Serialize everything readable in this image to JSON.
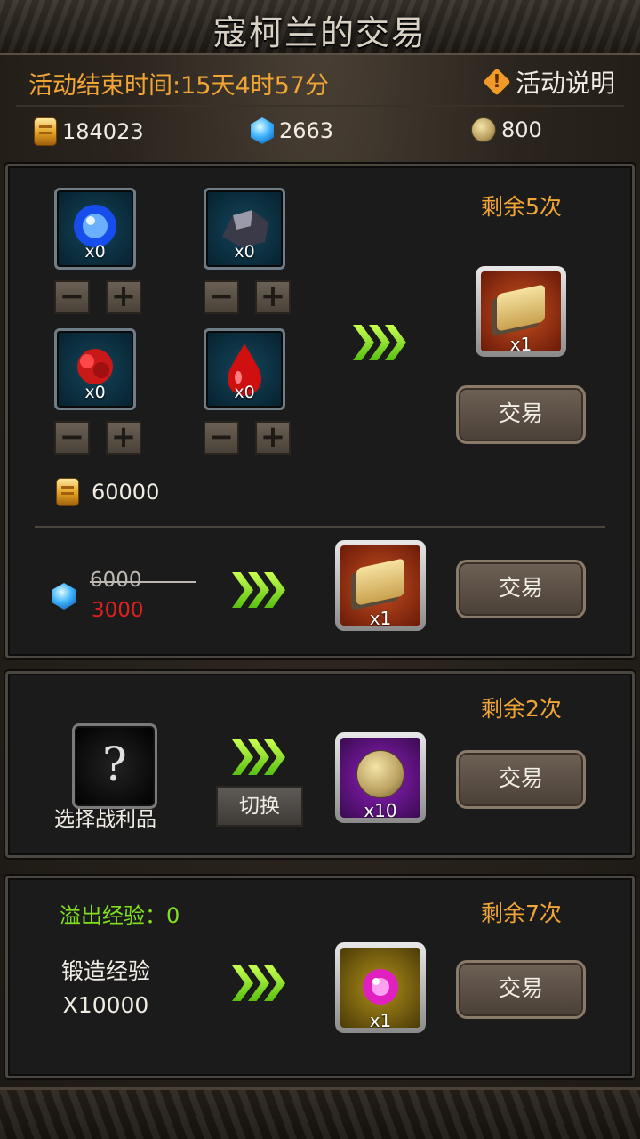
{
  "title": "寇柯兰的交易",
  "header": {
    "timer": "活动结束时间:15天4时57分",
    "info_icon": "!",
    "info_label": "活动说明"
  },
  "currencies": [
    {
      "icon": "gold-icon",
      "value": "184023"
    },
    {
      "icon": "gem-icon",
      "value": "2663"
    },
    {
      "icon": "coin-icon",
      "value": "800"
    }
  ],
  "panel1": {
    "remaining": "剩余5次",
    "materials": [
      {
        "icon": "blue-orb-icon",
        "count": "x0"
      },
      {
        "icon": "dark-ore-icon",
        "count": "x0"
      },
      {
        "icon": "red-crystal-icon",
        "count": "x0"
      },
      {
        "icon": "blood-drop-icon",
        "count": "x0"
      }
    ],
    "minus": "−",
    "plus": "+",
    "gold_cost": "60000",
    "reward_count": "x1",
    "trade_label": "交易",
    "gem_old_price": "6000",
    "gem_new_price": "3000",
    "reward2_count": "x1",
    "trade2_label": "交易"
  },
  "panel2": {
    "remaining": "剩余2次",
    "question": "?",
    "select_label": "选择战利品",
    "switch_label": "切换",
    "reward_count": "x10",
    "trade_label": "交易"
  },
  "panel3": {
    "overflow_label": "溢出经验：0",
    "remaining": "剩余7次",
    "exp_label": "锻造经验",
    "exp_amount": "X10000",
    "reward_count": "x1",
    "trade_label": "交易"
  },
  "colors": {
    "accent": "#f1a535",
    "green": "#80e020",
    "red_price": "#e02020"
  }
}
